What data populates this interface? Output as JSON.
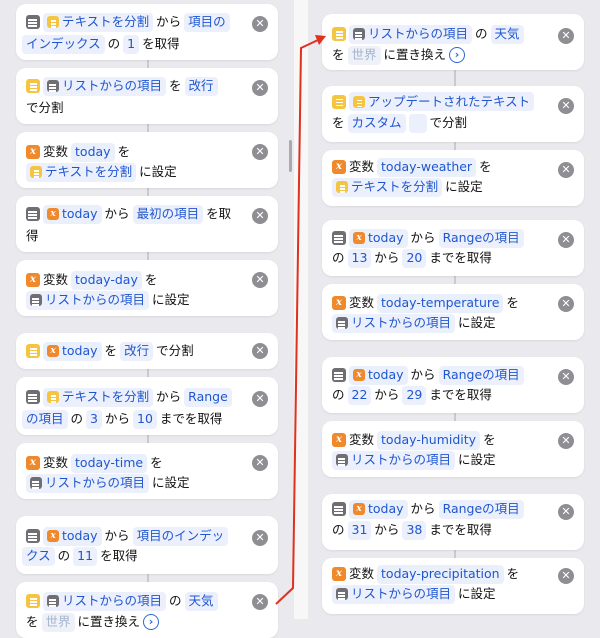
{
  "left": {
    "cards": [
      {
        "l1": {
          "icon": "text-icon",
          "a": "テキストを分割",
          "b": "から",
          "c": "項目の"
        },
        "l2": {
          "a": "インデックス",
          "b": "の",
          "c": "1",
          "d": "を取得"
        }
      },
      {
        "l1": {
          "icon": "list-icon",
          "a": "リストからの項目",
          "b": "を",
          "c": "改行"
        },
        "l2": {
          "a": "で分割"
        }
      },
      {
        "l1": {
          "a": "変数",
          "b": "today",
          "c": "を"
        },
        "l2": {
          "a": "テキストを分割",
          "b": "に設定"
        }
      },
      {
        "l1": {
          "a": "today",
          "b": "から",
          "c": "最初の項目",
          "d": "を取"
        },
        "l2": {
          "a": "得"
        }
      },
      {
        "l1": {
          "a": "変数",
          "b": "today-day",
          "c": "を"
        },
        "l2": {
          "a": "リストからの項目",
          "b": "に設定"
        }
      },
      {
        "l1": {
          "a": "today",
          "b": "を",
          "c": "改行",
          "d": "で分割"
        }
      },
      {
        "l1": {
          "a": "テキストを分割",
          "b": "から",
          "c": "Range"
        },
        "l2": {
          "a": "の項目",
          "b": "の",
          "c": "3",
          "d": "から",
          "e": "10",
          "f": "までを取得"
        }
      },
      {
        "l1": {
          "a": "変数",
          "b": "today-time",
          "c": "を"
        },
        "l2": {
          "a": "リストからの項目",
          "b": "に設定"
        }
      },
      {
        "l1": {
          "a": "today",
          "b": "から",
          "c": "項目のインデッ"
        },
        "l2": {
          "a": "クス",
          "b": "の",
          "c": "11",
          "d": "を取得"
        }
      },
      {
        "l1": {
          "a": "リストからの項目",
          "b": "の",
          "c": "天気"
        },
        "l2": {
          "a": "を",
          "b": "世界",
          "c": "に置き換え"
        }
      }
    ]
  },
  "right": {
    "cards": [
      {
        "l1": {
          "a": "リストからの項目",
          "b": "の",
          "c": "天気"
        },
        "l2": {
          "a": "を",
          "b": "世界",
          "c": "に置き換え"
        }
      },
      {
        "l1": {
          "a": "アップデートされたテキスト"
        },
        "l2": {
          "a": "を",
          "b": "カスタム",
          "c": "",
          "d": "で分割"
        }
      },
      {
        "l1": {
          "a": "変数",
          "b": "today-weather",
          "c": "を"
        },
        "l2": {
          "a": "テキストを分割",
          "b": "に設定"
        }
      },
      {
        "l1": {
          "a": "today",
          "b": "から",
          "c": "Rangeの項目"
        },
        "l2": {
          "a": "の",
          "b": "13",
          "c": "から",
          "d": "20",
          "e": "までを取得"
        }
      },
      {
        "l1": {
          "a": "変数",
          "b": "today-temperature",
          "c": "を"
        },
        "l2": {
          "a": "リストからの項目",
          "b": "に設定"
        }
      },
      {
        "l1": {
          "a": "today",
          "b": "から",
          "c": "Rangeの項目"
        },
        "l2": {
          "a": "の",
          "b": "22",
          "c": "から",
          "d": "29",
          "e": "までを取得"
        }
      },
      {
        "l1": {
          "a": "変数",
          "b": "today-humidity",
          "c": "を"
        },
        "l2": {
          "a": "リストからの項目",
          "b": "に設定"
        }
      },
      {
        "l1": {
          "a": "today",
          "b": "から",
          "c": "Rangeの項目"
        },
        "l2": {
          "a": "の",
          "b": "31",
          "c": "から",
          "d": "38",
          "e": "までを取得"
        }
      },
      {
        "l1": {
          "a": "変数",
          "b": "today-precipitation",
          "c": "を"
        },
        "l2": {
          "a": "リストからの項目",
          "b": "に設定"
        }
      }
    ]
  },
  "icons": {
    "remove": "✕",
    "expand": "›",
    "variable": "x"
  },
  "colors": {
    "token_text": "#1f56cf",
    "token_bg": "#ebf0fc",
    "text_action": "#f5c542",
    "list_action": "#6e6e73",
    "variable_action": "#f0892c",
    "arrow": "#e0301e"
  }
}
